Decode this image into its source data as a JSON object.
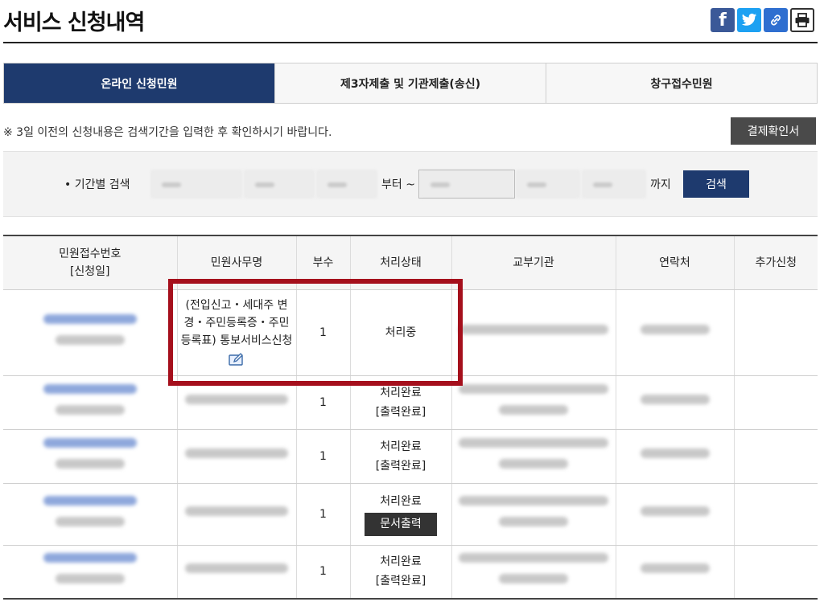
{
  "page": {
    "title": "서비스 신청내역"
  },
  "share_icons": [
    "facebook-icon",
    "twitter-icon",
    "link-icon",
    "print-icon"
  ],
  "tabs": [
    {
      "label": "온라인 신청민원",
      "active": true
    },
    {
      "label": "제3자제출 및 기관제출(송신)",
      "active": false
    },
    {
      "label": "창구접수민원",
      "active": false
    }
  ],
  "notice": "※ 3일 이전의 신청내용은 검색기간을 입력한 후 확인하시기 바랍니다.",
  "receipt_button": "결제확인서",
  "search": {
    "label": "• 기간별 검색",
    "from_text": "부터 ~",
    "to_text": "까지",
    "button": "검색"
  },
  "table": {
    "headers": {
      "receipt_no": "민원접수번호",
      "receipt_date": "[신청일]",
      "service": "민원사무명",
      "copies": "부수",
      "status": "처리상태",
      "agency": "교부기관",
      "contact": "연락처",
      "additional": "추가신청"
    },
    "rows": [
      {
        "service": "(전입신고・세대주 변경・주민등록증・주민등록표) 통보서비스신청",
        "copies": "1",
        "status": "처리중",
        "sub_status": ""
      },
      {
        "service": "",
        "copies": "1",
        "status": "처리완료",
        "sub_status": "[출력완료]"
      },
      {
        "service": "",
        "copies": "1",
        "status": "처리완료",
        "sub_status": "[출력완료]"
      },
      {
        "service": "",
        "copies": "1",
        "status": "처리완료",
        "sub_status": "",
        "button": "문서출력"
      },
      {
        "service": "",
        "copies": "1",
        "status": "처리완료",
        "sub_status": "[출력완료]"
      }
    ]
  },
  "colors": {
    "primary_navy": "#1e3a6e",
    "highlight_red": "#a50f1c",
    "dark_button": "#333333"
  }
}
